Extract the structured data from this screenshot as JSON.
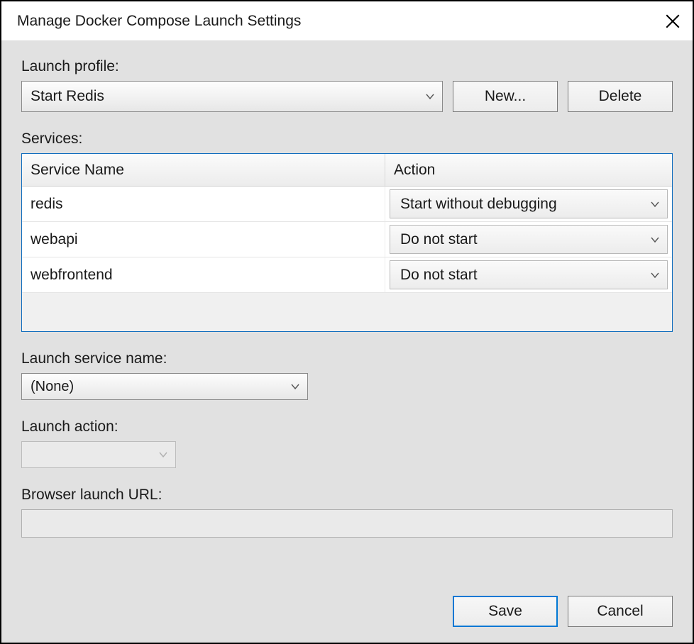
{
  "window": {
    "title": "Manage Docker Compose Launch Settings"
  },
  "labels": {
    "launch_profile": "Launch profile:",
    "services": "Services:",
    "launch_service_name": "Launch service name:",
    "launch_action": "Launch action:",
    "browser_launch_url": "Browser launch URL:"
  },
  "launch_profile": {
    "selected": "Start Redis"
  },
  "buttons": {
    "new": "New...",
    "delete": "Delete",
    "save": "Save",
    "cancel": "Cancel"
  },
  "services_table": {
    "columns": {
      "name": "Service Name",
      "action": "Action"
    },
    "rows": [
      {
        "name": "redis",
        "action": "Start without debugging"
      },
      {
        "name": "webapi",
        "action": "Do not start"
      },
      {
        "name": "webfrontend",
        "action": "Do not start"
      }
    ]
  },
  "launch_service_name": {
    "selected": "(None)"
  },
  "launch_action": {
    "selected": ""
  },
  "browser_launch_url": {
    "value": ""
  }
}
